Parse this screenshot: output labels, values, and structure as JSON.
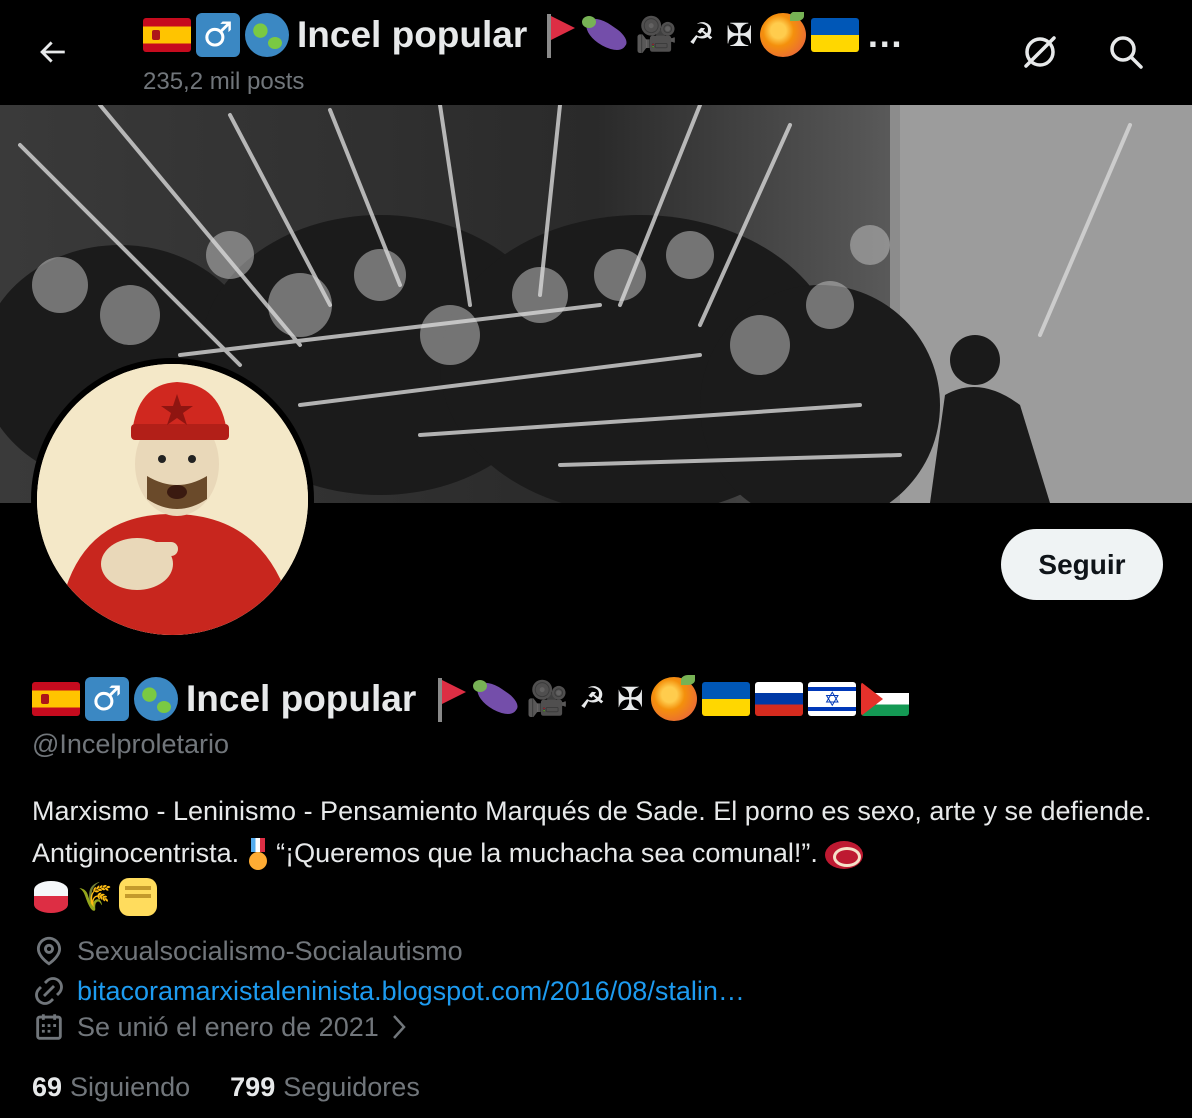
{
  "header": {
    "title": "Incel popular",
    "post_count": "235,2 mil posts"
  },
  "profile": {
    "display_name": "Incel popular",
    "handle": "@Incelproletario",
    "follow_label": "Seguir",
    "bio": {
      "line_a": "Marxismo - Leninismo - Pensamiento Marqués de Sade. El porno es sexo, arte y se defiende. Antiginocentrista.",
      "line_b": "“¡Queremos que la muchacha sea comunal!”."
    },
    "location": "Sexualsocialismo-Socialautismo",
    "website": "bitacoramarxistaleninista.blogspot.com/2016/08/stalin…",
    "joined": "Se unió el enero de 2021",
    "following_count": "69",
    "following_label": "Siguiendo",
    "followers_count": "799",
    "followers_label": "Seguidores"
  },
  "icons": {
    "back": "arrow-left-icon",
    "grok": "grok-icon",
    "search": "search-icon",
    "location": "location-pin-icon",
    "link": "link-icon",
    "calendar": "calendar-icon",
    "chevron": "chevron-right-icon"
  },
  "name_emojis": [
    "spain-flag",
    "male-sign",
    "globe",
    "red-flag",
    "eggplant",
    "movie-camera",
    "hammer-and-sickle",
    "maltese-cross",
    "peach",
    "ukraine-flag",
    "russia-flag",
    "israel-flag",
    "palestine-flag"
  ],
  "colors": {
    "background": "#000000",
    "text": "#e7e9ea",
    "muted": "#71767b",
    "link": "#1d9bf0",
    "button_bg": "#eff3f4"
  }
}
